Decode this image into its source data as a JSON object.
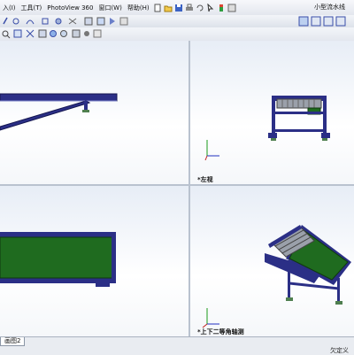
{
  "menu": {
    "items": [
      "入(I)",
      "工具(T)",
      "PhotoView 360",
      "窗口(W)",
      "帮助(H)"
    ],
    "document_title": "小型流水线"
  },
  "viewports": {
    "top_right": {
      "label": "*左视"
    },
    "bottom_right": {
      "label": "*上下二等角轴测"
    }
  },
  "statusbar": {
    "tab_label": "画图2",
    "status_text": "欠定义"
  },
  "colors": {
    "frame": "#2b2f86",
    "belt": "#1f6b1f",
    "roller": "#9aa0aa",
    "viewport_bg_top": "#e7edf6"
  }
}
